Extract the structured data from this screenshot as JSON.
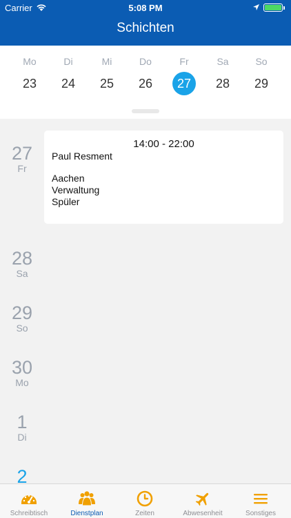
{
  "status": {
    "carrier": "Carrier",
    "time": "5:08 PM"
  },
  "header": {
    "title": "Schichten"
  },
  "week": {
    "days": [
      {
        "name": "Mo",
        "num": "23"
      },
      {
        "name": "Di",
        "num": "24"
      },
      {
        "name": "Mi",
        "num": "25"
      },
      {
        "name": "Do",
        "num": "26"
      },
      {
        "name": "Fr",
        "num": "27"
      },
      {
        "name": "Sa",
        "num": "28"
      },
      {
        "name": "So",
        "num": "29"
      }
    ],
    "selected_index": 4
  },
  "timeline": {
    "days": [
      {
        "num": "27",
        "wd": "Fr"
      },
      {
        "num": "28",
        "wd": "Sa"
      },
      {
        "num": "29",
        "wd": "So"
      },
      {
        "num": "30",
        "wd": "Mo"
      },
      {
        "num": "1",
        "wd": "Di"
      },
      {
        "num": "2",
        "wd": ""
      }
    ]
  },
  "shift": {
    "time": "14:00 - 22:00",
    "person": "Paul Resment",
    "location": "Aachen",
    "department": "Verwaltung",
    "role": "Spüler"
  },
  "tabs": [
    {
      "label": "Schreibtisch",
      "icon": "speedometer-icon"
    },
    {
      "label": "Dienstplan",
      "icon": "people-icon"
    },
    {
      "label": "Zeiten",
      "icon": "clock-icon"
    },
    {
      "label": "Abwesenheit",
      "icon": "airplane-icon"
    },
    {
      "label": "Sonstiges",
      "icon": "menu-icon"
    }
  ],
  "colors": {
    "header": "#0b5cb3",
    "accent": "#1aa3e8",
    "tab_icon": "#f0a000"
  }
}
